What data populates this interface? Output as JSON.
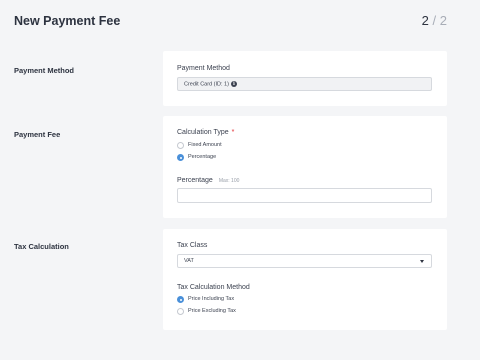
{
  "header": {
    "title": "New Payment Fee",
    "step_current": "2",
    "step_separator": "/",
    "step_total": "2"
  },
  "sections": {
    "payment_method": {
      "label": "Payment Method",
      "field_label": "Payment Method",
      "value": "Credit Card (ID: 1)",
      "info_glyph": "i"
    },
    "payment_fee": {
      "label": "Payment Fee",
      "calc_type_label": "Calculation Type",
      "required_marker": "*",
      "options": [
        {
          "label": "Fixed Amount",
          "checked": false
        },
        {
          "label": "Percentage",
          "checked": true
        }
      ],
      "percentage_label": "Percentage",
      "percentage_hint": "Max: 100",
      "percentage_value": ""
    },
    "tax": {
      "label": "Tax Calculation",
      "tax_class_label": "Tax Class",
      "tax_class_value": "VAT",
      "method_label": "Tax Calculation Method",
      "options": [
        {
          "label": "Price Including Tax",
          "checked": true
        },
        {
          "label": "Price Excluding Tax",
          "checked": false
        }
      ]
    }
  },
  "colors": {
    "page_bg": "#f4f5f7",
    "card_bg": "#ffffff",
    "accent": "#4a90d9",
    "required": "#e0262b"
  }
}
